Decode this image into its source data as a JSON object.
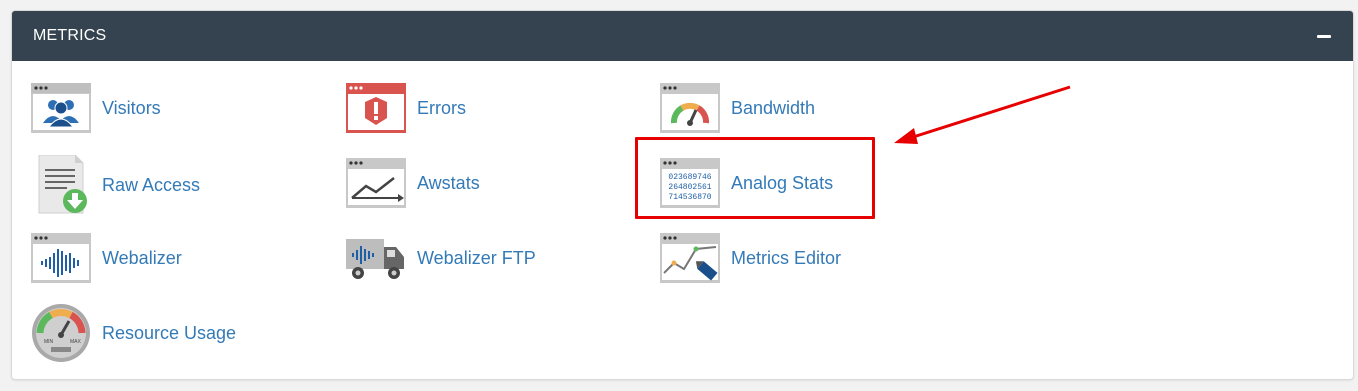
{
  "panel": {
    "title": "METRICS",
    "collapse_icon": "minus-icon"
  },
  "items": [
    {
      "label": "Visitors",
      "icon": "visitors-icon"
    },
    {
      "label": "Errors",
      "icon": "errors-icon"
    },
    {
      "label": "Bandwidth",
      "icon": "bandwidth-icon"
    },
    {
      "label": "Raw Access",
      "icon": "raw-access-icon"
    },
    {
      "label": "Awstats",
      "icon": "awstats-icon"
    },
    {
      "label": "Analog Stats",
      "icon": "analog-stats-icon",
      "icon_text": [
        "023689746",
        "264802561",
        "714536870"
      ]
    },
    {
      "label": "Webalizer",
      "icon": "webalizer-icon"
    },
    {
      "label": "Webalizer FTP",
      "icon": "webalizer-ftp-icon"
    },
    {
      "label": "Metrics Editor",
      "icon": "metrics-editor-icon"
    },
    {
      "label": "Resource Usage",
      "icon": "resource-usage-icon",
      "icon_text": [
        "MIN",
        "MAX"
      ]
    }
  ],
  "annotation": {
    "highlight_target": "Analog Stats",
    "highlight_color": "#e60000"
  },
  "colors": {
    "header_bg": "#34434f",
    "link": "#337ab7",
    "icon_frame": "#c6c6c6",
    "icon_blue": "#1f5fa7",
    "icon_red": "#d9534f"
  }
}
